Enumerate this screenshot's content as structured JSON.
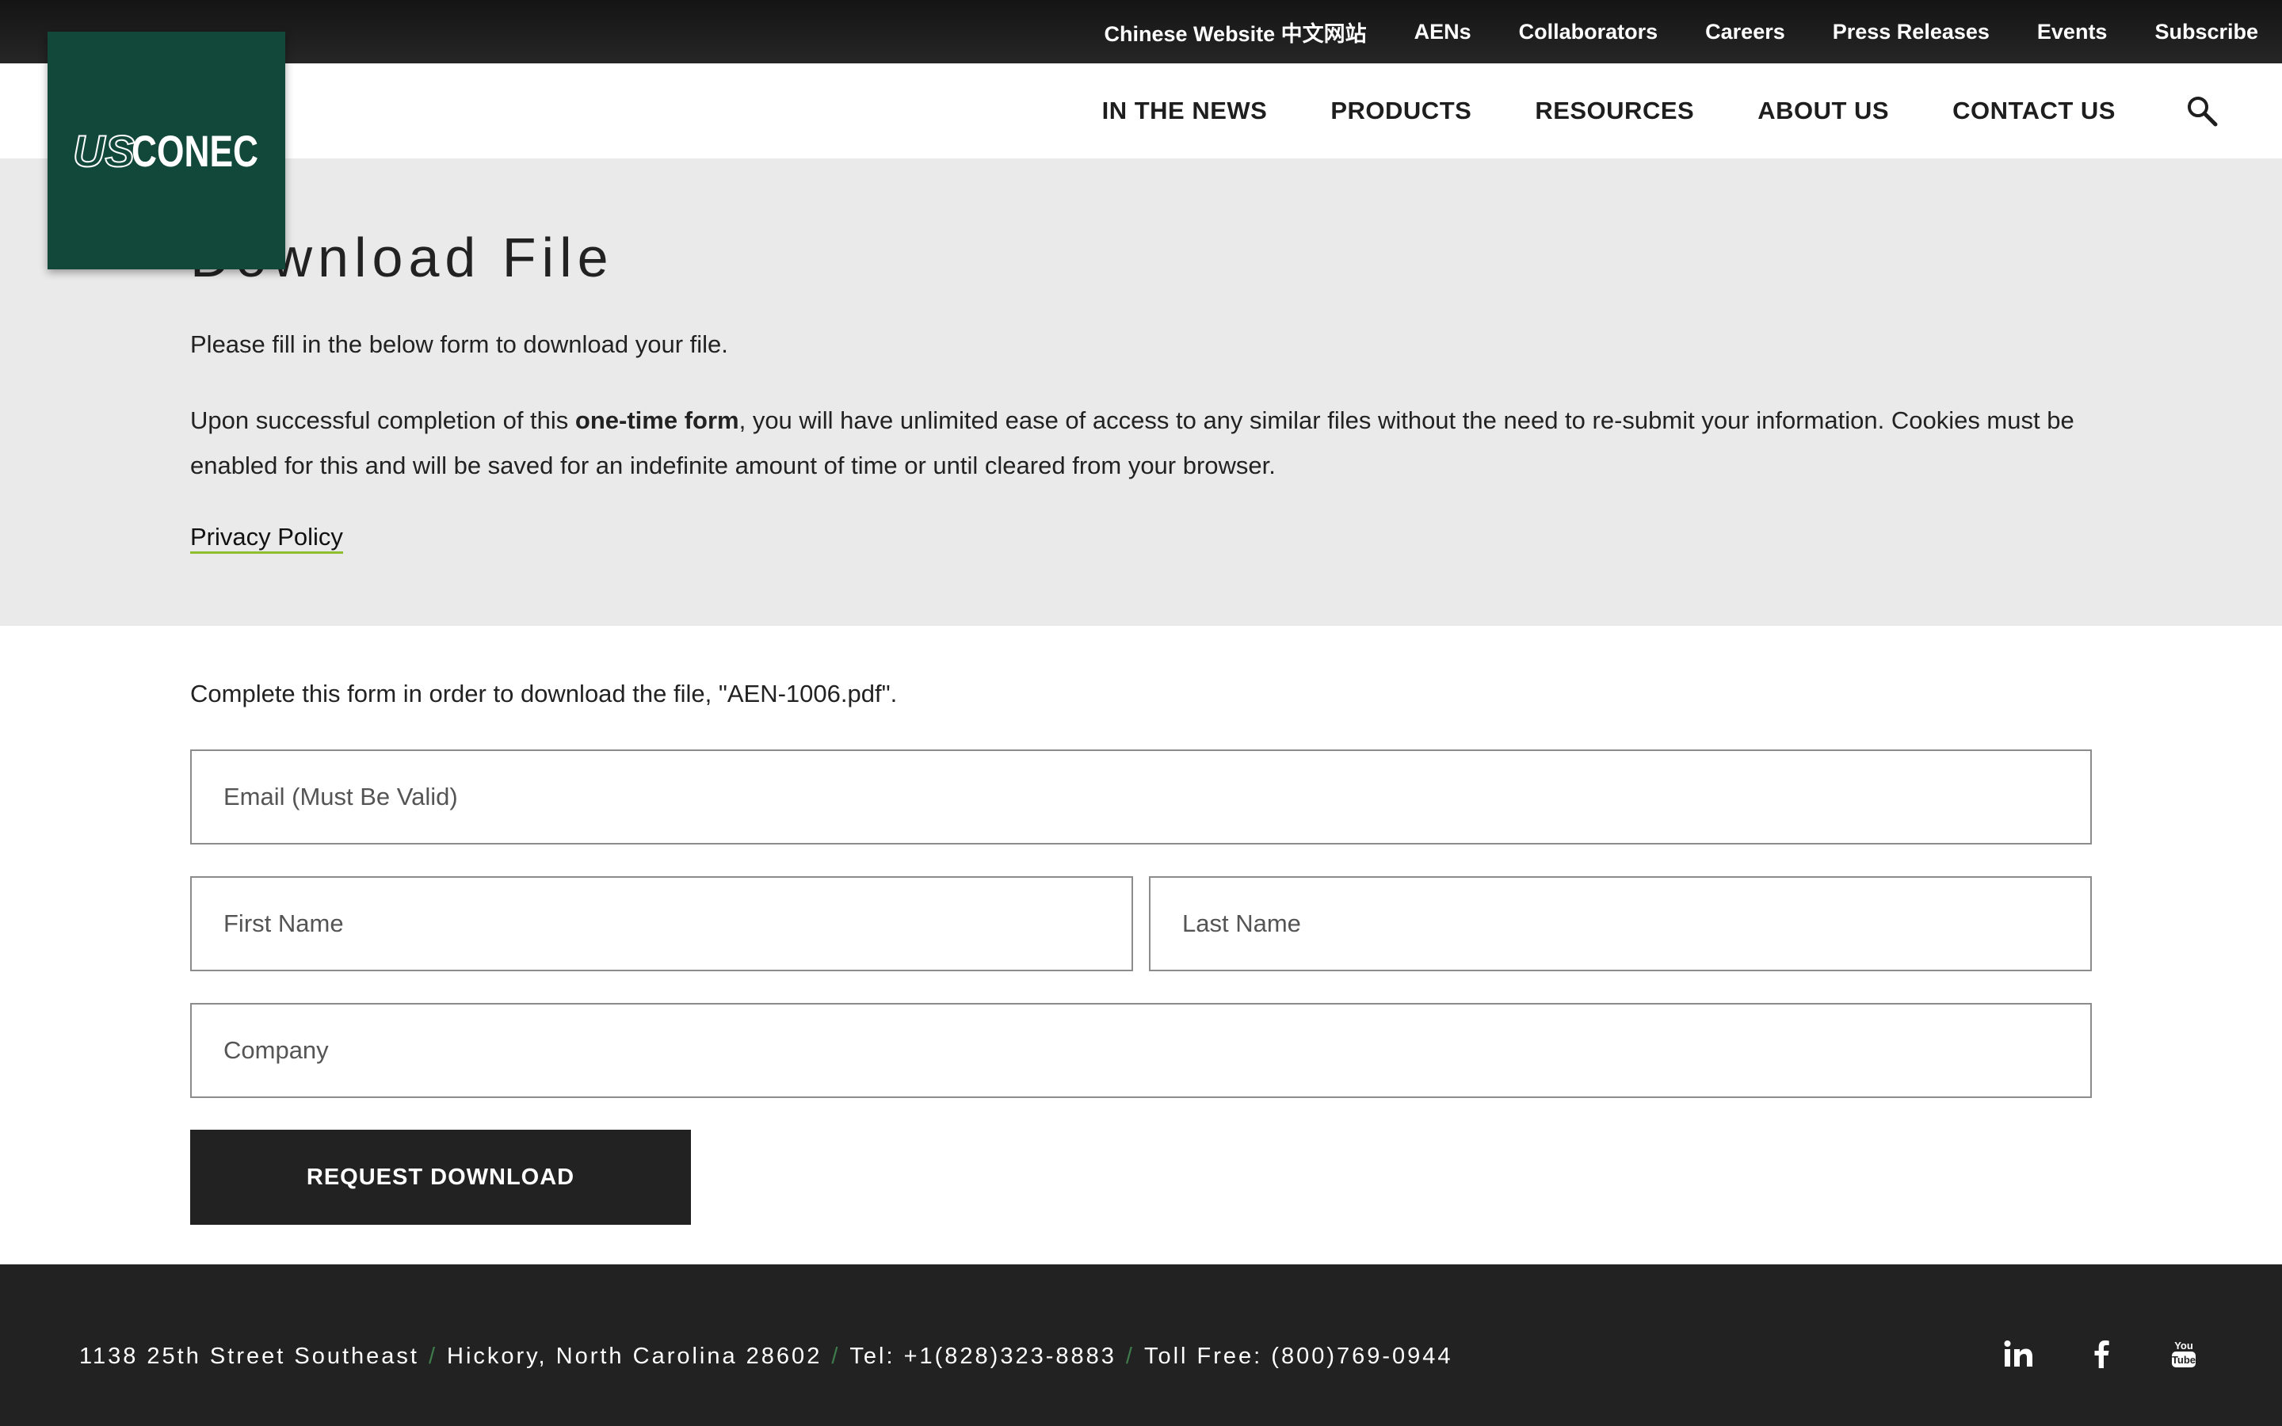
{
  "topbar": {
    "links": [
      "Chinese Website 中文网站",
      "AENs",
      "Collaborators",
      "Careers",
      "Press Releases",
      "Events",
      "Subscribe"
    ]
  },
  "logo": {
    "text_us": "US",
    "text_conec": "CONEC",
    "bg": "#12483a"
  },
  "nav": {
    "items": [
      "IN THE NEWS",
      "PRODUCTS",
      "RESOURCES",
      "ABOUT US",
      "CONTACT US"
    ],
    "search_icon": "search-icon"
  },
  "hero": {
    "title": "Download File",
    "intro": "Please fill in the below form to download your file.",
    "notice_pre": "Upon successful completion of this ",
    "notice_bold": "one-time form",
    "notice_post": ", you will have unlimited ease of access to any similar files without the need to re-submit your information. Cookies must be enabled for this and will be saved for an indefinite amount of time or until cleared from your browser.",
    "privacy_link": "Privacy Policy"
  },
  "form": {
    "intro": "Complete this form in order to download the file, \"AEN-1006.pdf\".",
    "email_placeholder": "Email (Must Be Valid)",
    "first_name_placeholder": "First Name",
    "last_name_placeholder": "Last Name",
    "company_placeholder": "Company",
    "submit_label": "REQUEST DOWNLOAD"
  },
  "footer": {
    "address_street": "1138 25th Street Southeast",
    "address_city": "Hickory, North Carolina 28602",
    "tel": "Tel: +1(828)323-8883",
    "toll_free": "Toll Free: (800)769-0944",
    "separator": "/",
    "social_icons": [
      "linkedin-icon",
      "facebook-icon",
      "youtube-icon"
    ],
    "youtube_you": "You",
    "youtube_tube": "Tube"
  },
  "colors": {
    "accent_green": "#12483a",
    "link_underline": "#8fbf2f",
    "separator": "#3f7c4c",
    "dark": "#222222",
    "hero_bg": "#eaeaea"
  }
}
